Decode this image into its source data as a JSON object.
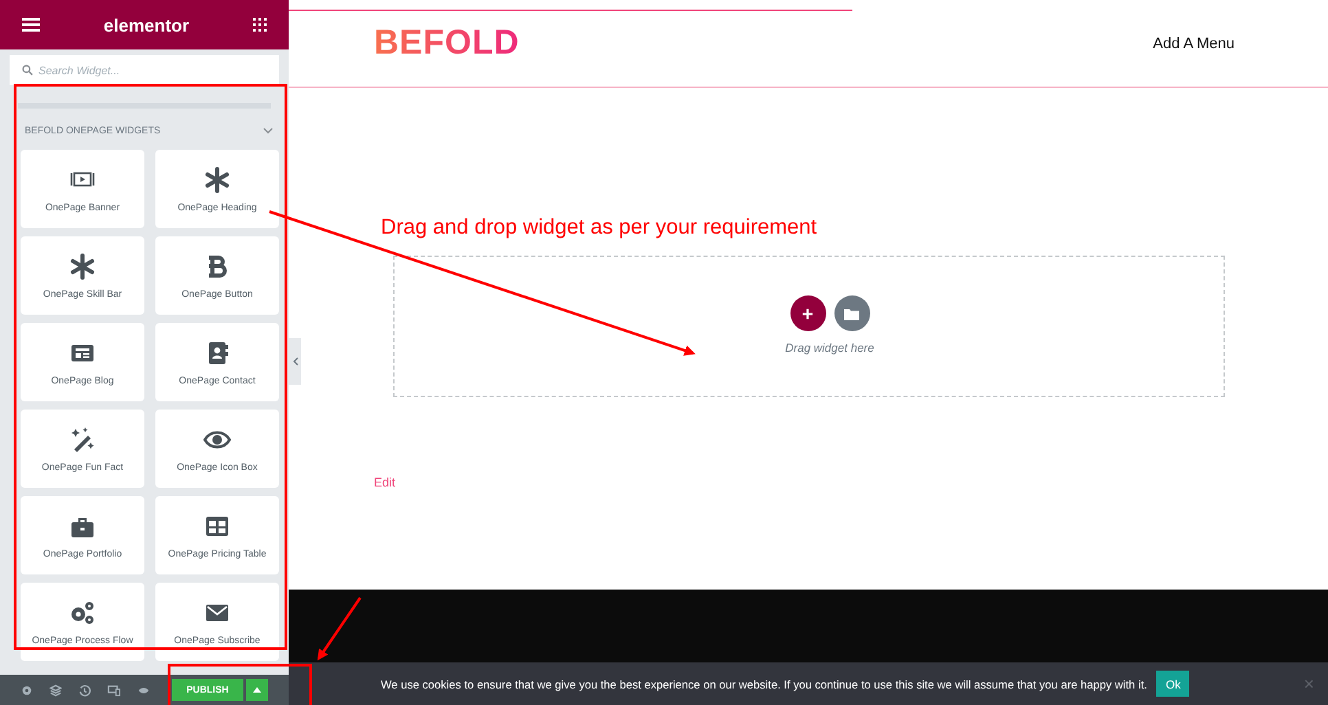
{
  "sidebar": {
    "title": "elementor",
    "search": {
      "placeholder": "Search Widget..."
    },
    "category": {
      "title": "BEFOLD ONEPAGE WIDGETS",
      "expanded": true
    },
    "widgets": [
      {
        "label": "OnePage Banner"
      },
      {
        "label": "OnePage Heading"
      },
      {
        "label": "OnePage Skill Bar"
      },
      {
        "label": "OnePage Button"
      },
      {
        "label": "OnePage Blog"
      },
      {
        "label": "OnePage Contact"
      },
      {
        "label": "OnePage Fun Fact"
      },
      {
        "label": "OnePage Icon Box"
      },
      {
        "label": "OnePage Portfolio"
      },
      {
        "label": "OnePage Pricing Table"
      },
      {
        "label": "OnePage Process Flow"
      },
      {
        "label": "OnePage Subscribe"
      }
    ],
    "footer": {
      "publish": "PUBLISH"
    }
  },
  "page": {
    "logo": "BEFOLD",
    "menu": "Add A Menu",
    "annotation": "Drag and drop widget as per your requirement",
    "dropzone": {
      "hint": "Drag widget here"
    },
    "edit_link": "Edit"
  },
  "cookie_bar": {
    "message": "We use cookies to ensure that we give you the best experience on our website. If you continue to use this site we will assume that you are happy with it.",
    "button": "Ok",
    "close": "×"
  }
}
